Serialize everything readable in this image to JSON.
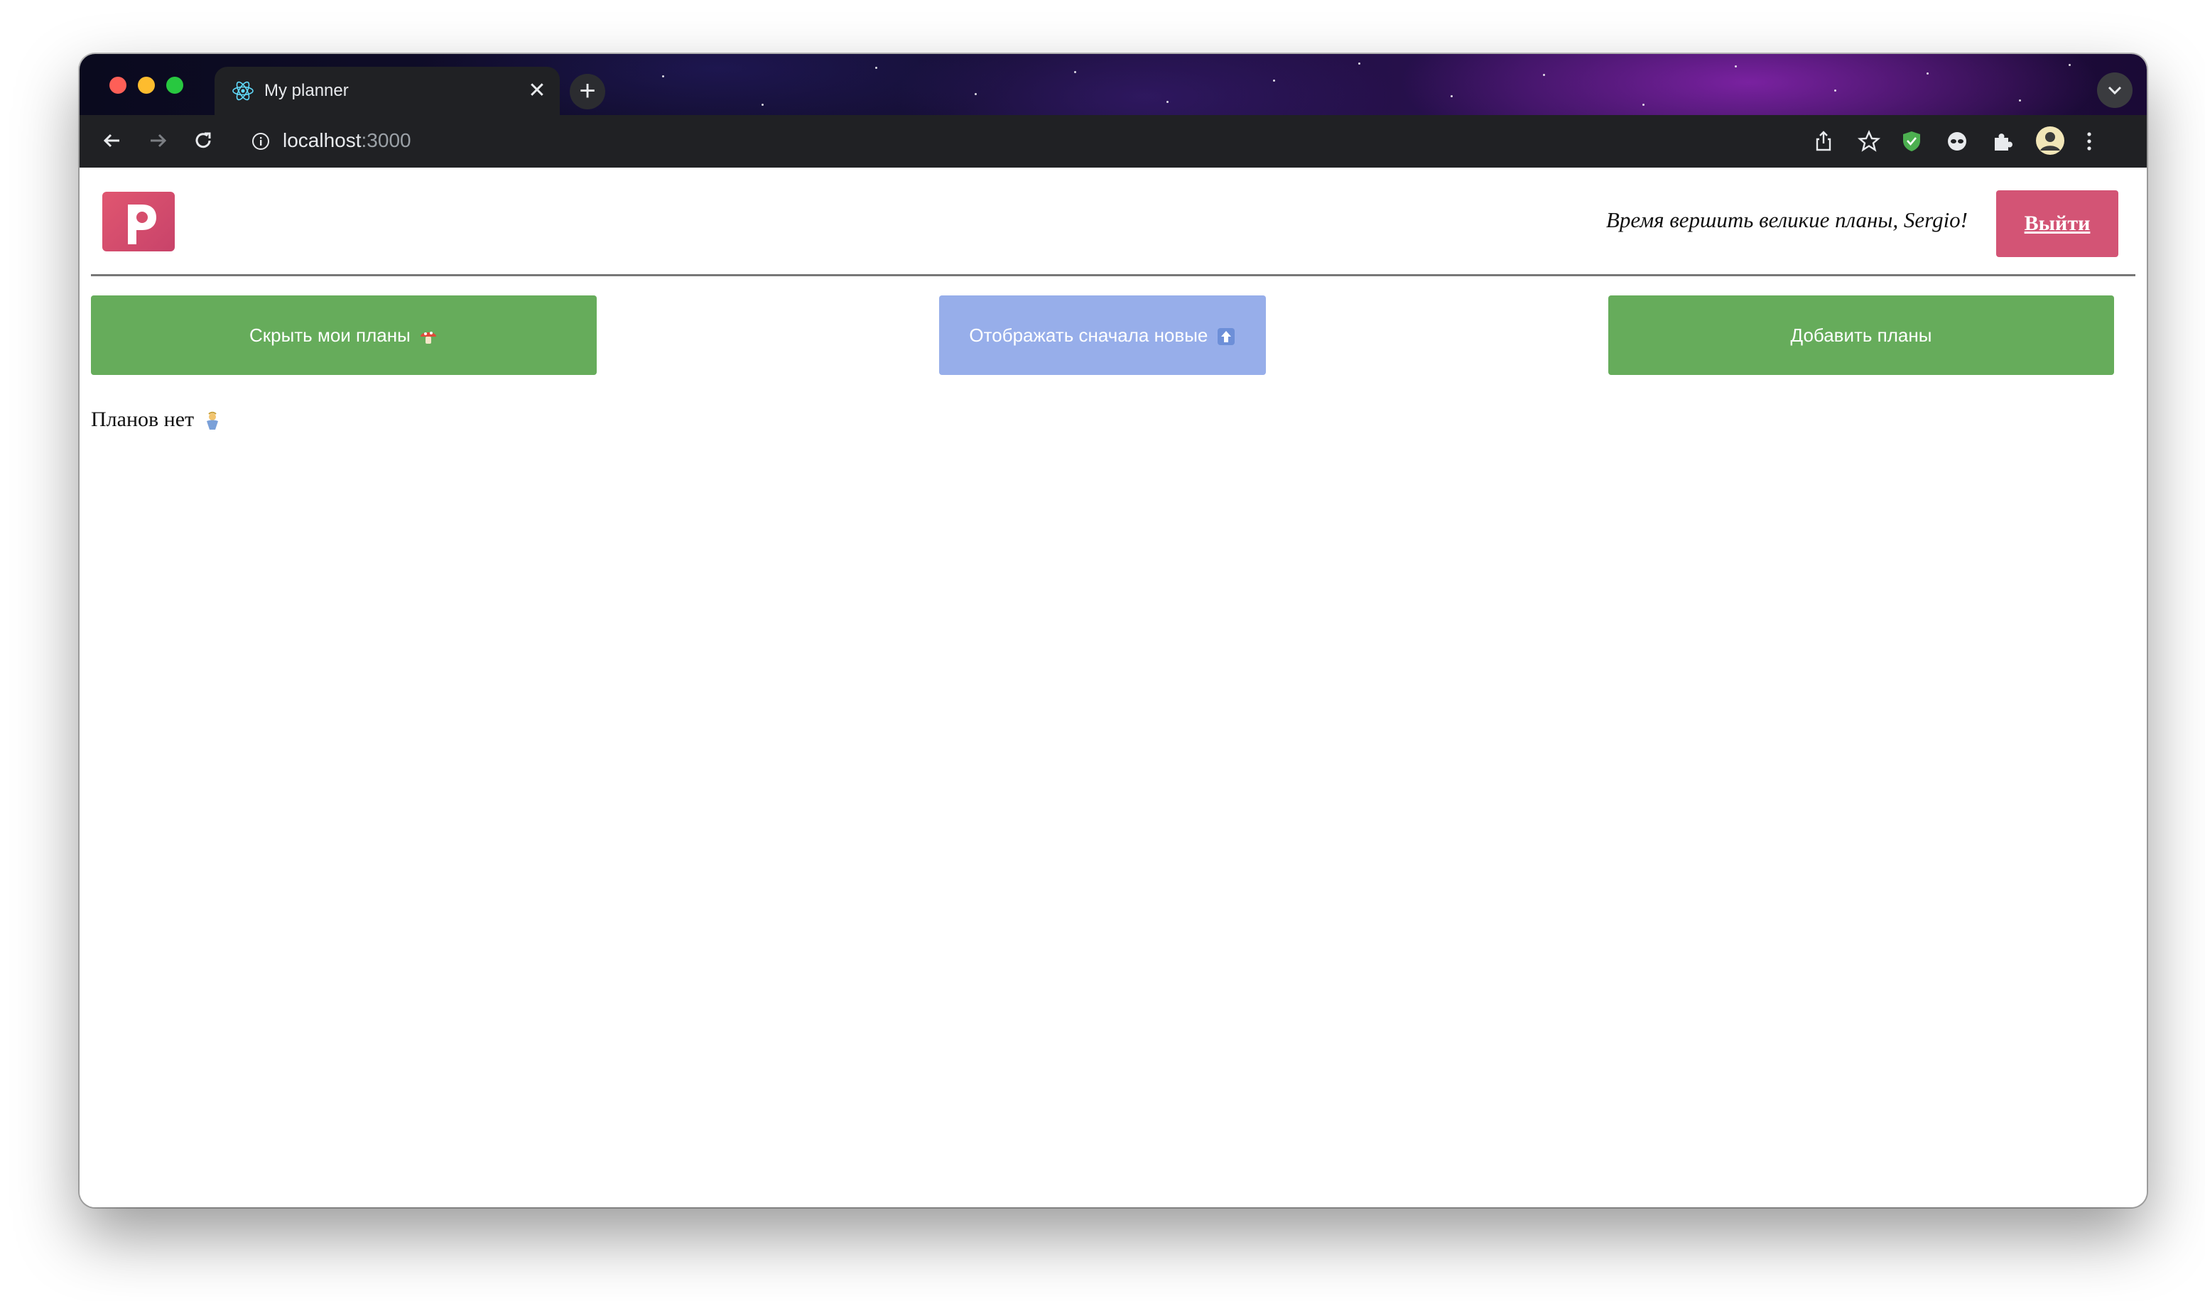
{
  "browser": {
    "tab_title": "My planner",
    "tab_close": "✕",
    "new_tab": "+",
    "url_host": "localhost",
    "url_port": ":3000"
  },
  "app": {
    "greeting": "Время вершить великие планы, Sergio!",
    "logout_label": "Выйти",
    "buttons": {
      "hide_plans": "Скрыть мои планы",
      "sort_newest": "Отображать сначала новые",
      "add_plans": "Добавить планы"
    },
    "empty_message": "Планов нет"
  },
  "colors": {
    "green_button": "#66ac5b",
    "blue_button": "#97aeea",
    "logout_button": "#d35475",
    "logo": "#d64e6c"
  }
}
